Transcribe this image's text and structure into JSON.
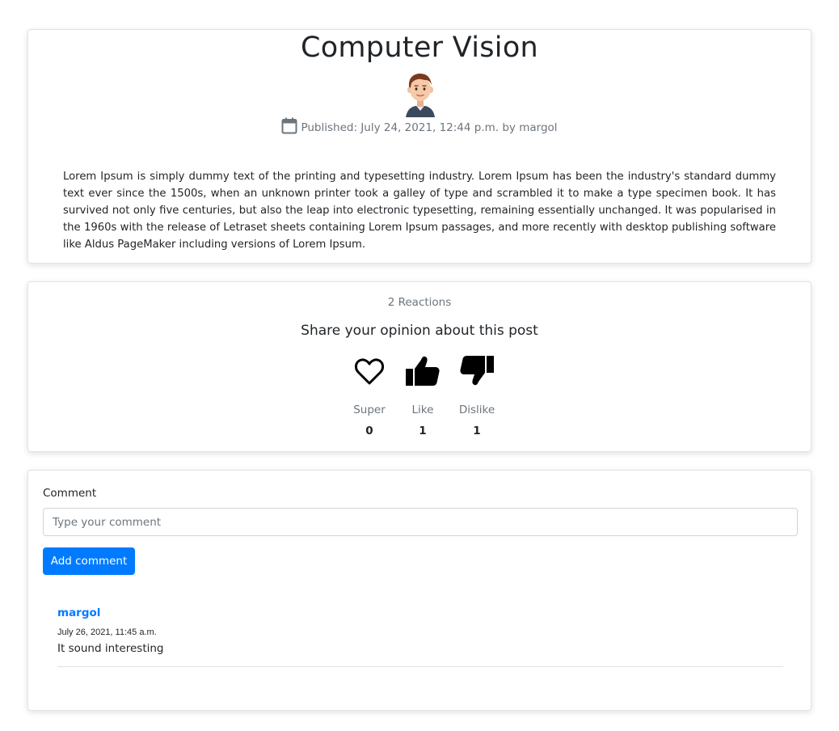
{
  "post": {
    "title": "Computer Vision",
    "avatar_icon": "avatar-boy-icon",
    "calendar_icon": "calendar-icon",
    "published_text": "Published: July 24, 2021, 12:44 p.m. by margol",
    "body": "Lorem Ipsum is simply dummy text of the printing and typesetting industry. Lorem Ipsum has been the industry's standard dummy text ever since the 1500s, when an unknown printer took a galley of type and scrambled it to make a type specimen book. It has survived not only five centuries, but also the leap into electronic typesetting, remaining essentially unchanged. It was popularised in the 1960s with the release of Letraset sheets containing Lorem Ipsum passages, and more recently with desktop publishing software like Aldus PageMaker including versions of Lorem Ipsum."
  },
  "reactions": {
    "count_text": "2 Reactions",
    "heading": "Share your opinion about this post",
    "items": [
      {
        "icon": "heart-outline-icon",
        "label": "Super",
        "count": "0"
      },
      {
        "icon": "thumbs-up-icon",
        "label": "Like",
        "count": "1"
      },
      {
        "icon": "thumbs-down-icon",
        "label": "Dislike",
        "count": "1"
      }
    ]
  },
  "comment_form": {
    "label": "Comment",
    "placeholder": "Type your comment",
    "value": "",
    "submit_label": "Add comment"
  },
  "comments": [
    {
      "author": "margol",
      "date": "July 26, 2021, 11:45 a.m.",
      "text": "It sound interesting"
    }
  ],
  "colors": {
    "accent": "#007bff",
    "muted": "#6c757d",
    "text": "#212529"
  }
}
